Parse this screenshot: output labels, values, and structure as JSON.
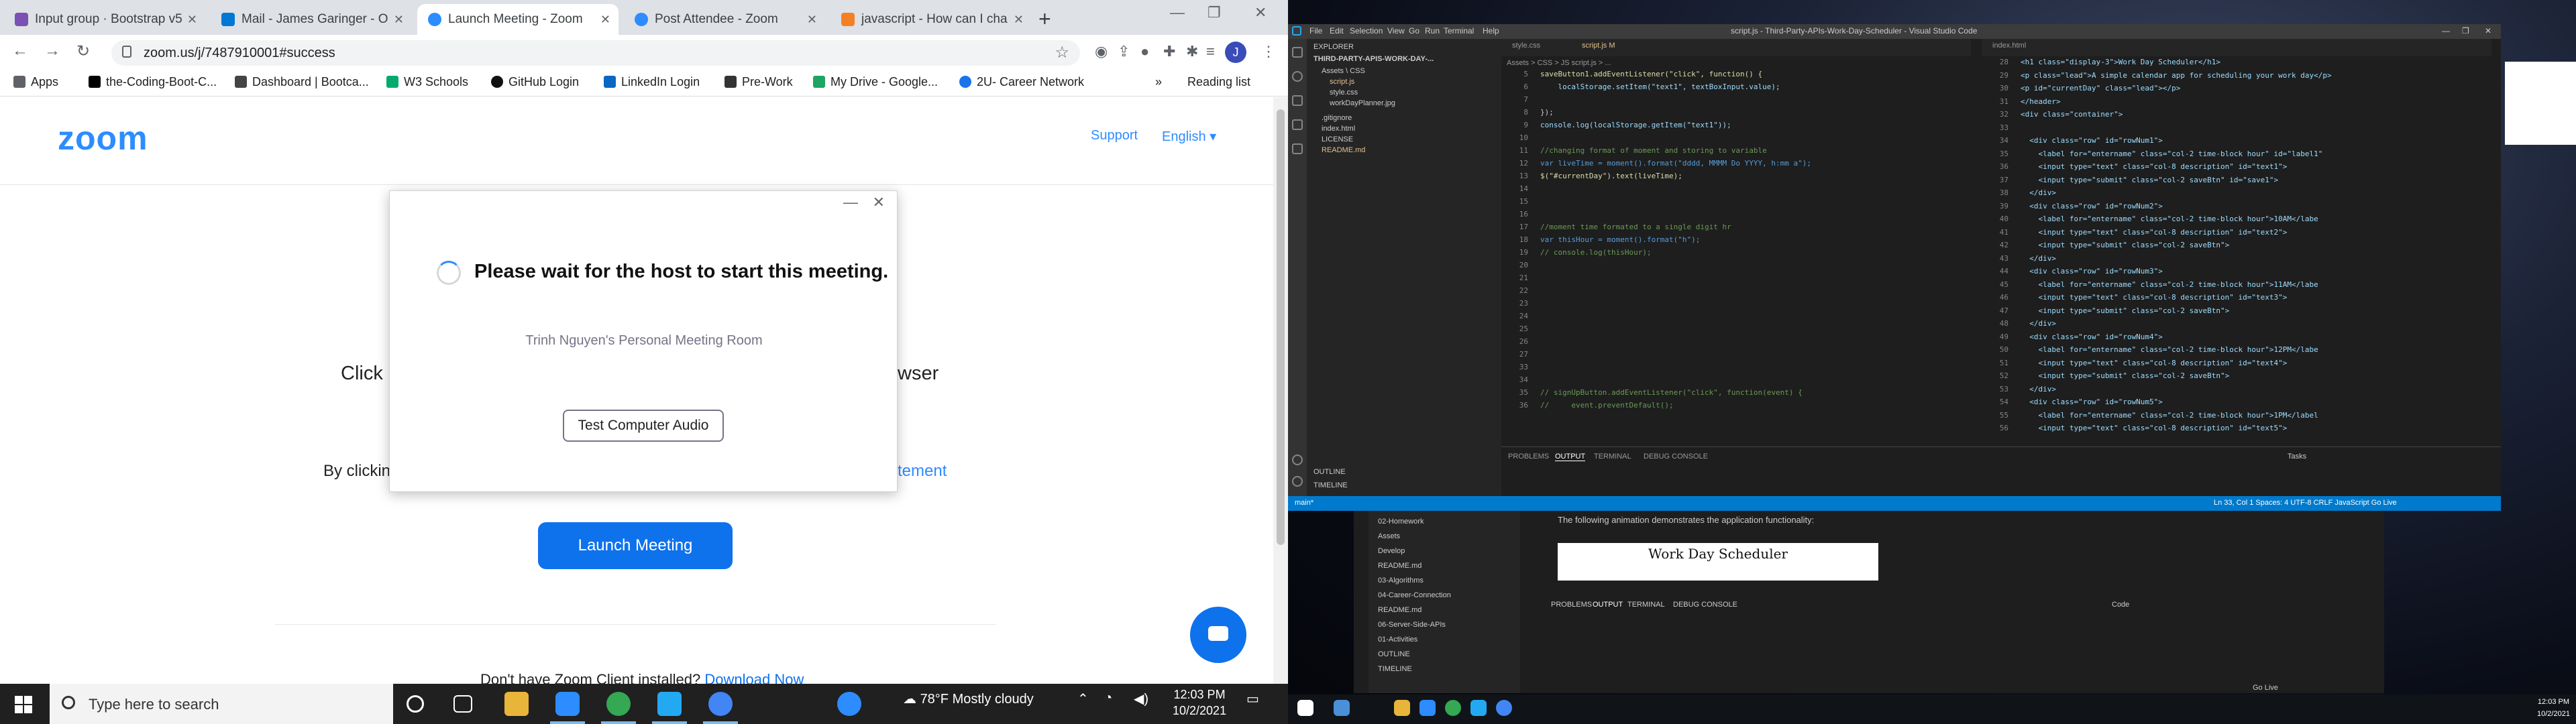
{
  "browser": {
    "tabs": [
      {
        "title": "Input group · Bootstrap v5",
        "color": "#7952b3"
      },
      {
        "title": "Mail - James Garinger - O",
        "color": "#0078d4"
      },
      {
        "title": "Launch Meeting - Zoom",
        "color": "#2d8cff"
      },
      {
        "title": "Post Attendee - Zoom",
        "color": "#2d8cff"
      },
      {
        "title": "javascript - How can I cha",
        "color": "#f48024"
      }
    ],
    "url": "zoom.us/j/7487910001#success",
    "avatar_letter": "J",
    "bookmarks": [
      {
        "label": "Apps",
        "color": "#5f6368"
      },
      {
        "label": "the-Coding-Boot-C...",
        "color": "#000000"
      },
      {
        "label": "Dashboard | Bootca...",
        "color": "#444444"
      },
      {
        "label": "W3 Schools",
        "color": "#04aa6d"
      },
      {
        "label": "GitHub Login",
        "color": "#111111"
      },
      {
        "label": "LinkedIn Login",
        "color": "#0a66c2"
      },
      {
        "label": "Pre-Work",
        "color": "#333333"
      },
      {
        "label": "My Drive - Google...",
        "color": "#1fa463"
      },
      {
        "label": "2U- Career Network",
        "color": "#1a73e8"
      }
    ],
    "reading_list": "Reading list",
    "more": "»"
  },
  "zoom": {
    "logo": "zoom",
    "support": "Support",
    "language": "English ▾",
    "click_text": "Click",
    "browser_text": "wser",
    "by_clicking": "By clickin",
    "statement": "tement",
    "launch_button": "Launch Meeting",
    "download_text": "Don't have Zoom Client installed?",
    "download_link": "Download Now"
  },
  "dialog": {
    "minimize": "—",
    "close": "✕",
    "message": "Please wait for the host to start this meeting.",
    "room": "Trinh Nguyen's Personal Meeting Room",
    "test_audio": "Test Computer Audio"
  },
  "taskbar": {
    "search_placeholder": "Type here to search",
    "weather": "78°F  Mostly cloudy",
    "time": "12:03 PM",
    "date": "10/2/2021"
  },
  "vscode": {
    "menu": [
      "File",
      "Edit",
      "Selection",
      "View",
      "Go",
      "Run",
      "Terminal",
      "Help"
    ],
    "title": "script.js - Third-Party-APIs-Work-Day-Scheduler - Visual Studio Code",
    "explorer": "EXPLORER",
    "project": "THIRD-PARTY-APIS-WORK-DAY-...",
    "files": [
      "Assets \\ CSS",
      "script.js",
      "style.css",
      "workDayPlanner.jpg",
      ".gitignore",
      "index.html",
      "LICENSE",
      "README.md"
    ],
    "tabs_left": [
      "style.css",
      "script.js M"
    ],
    "breadcrumb": "Assets > CSS > JS script.js > ...",
    "code_lines": [
      {
        "n": "5",
        "t": "saveButton1.addEventListener(\"click\", function() {",
        "c": "#dcdcaa"
      },
      {
        "n": "6",
        "t": "    localStorage.setItem(\"text1\", textBoxInput.value);",
        "c": "#9cdcfe"
      },
      {
        "n": "7",
        "t": "",
        "c": "#ccc"
      },
      {
        "n": "8",
        "t": "});",
        "c": "#ccc"
      },
      {
        "n": "9",
        "t": "console.log(localStorage.getItem(\"text1\"));",
        "c": "#9cdcfe"
      },
      {
        "n": "10",
        "t": "",
        "c": "#ccc"
      },
      {
        "n": "11",
        "t": "//changing format of moment and storing to variable",
        "c": "#6a9955"
      },
      {
        "n": "12",
        "t": "var liveTime = moment().format(\"dddd, MMMM Do YYYY, h:mm a\");",
        "c": "#569cd6"
      },
      {
        "n": "13",
        "t": "$(\"#currentDay\").text(liveTime);",
        "c": "#dcdcaa"
      },
      {
        "n": "14",
        "t": "",
        "c": "#ccc"
      },
      {
        "n": "15",
        "t": "",
        "c": "#ccc"
      },
      {
        "n": "16",
        "t": "",
        "c": "#ccc"
      },
      {
        "n": "17",
        "t": "//moment time formated to a single digit hr",
        "c": "#6a9955"
      },
      {
        "n": "18",
        "t": "var thisHour = moment().format(\"h\");",
        "c": "#569cd6"
      },
      {
        "n": "19",
        "t": "// console.log(thisHour);",
        "c": "#6a9955"
      },
      {
        "n": "20",
        "t": "",
        "c": "#ccc"
      },
      {
        "n": "21",
        "t": "",
        "c": "#ccc"
      },
      {
        "n": "22",
        "t": "",
        "c": "#ccc"
      },
      {
        "n": "23",
        "t": "",
        "c": "#ccc"
      },
      {
        "n": "24",
        "t": "",
        "c": "#ccc"
      },
      {
        "n": "25",
        "t": "",
        "c": "#ccc"
      },
      {
        "n": "26",
        "t": "",
        "c": "#ccc"
      },
      {
        "n": "27",
        "t": "",
        "c": "#ccc"
      },
      {
        "n": "33",
        "t": "",
        "c": "#ccc"
      },
      {
        "n": "34",
        "t": "",
        "c": "#ccc"
      },
      {
        "n": "35",
        "t": "// signUpButton.addEventListener(\"click\", function(event) {",
        "c": "#6a9955"
      },
      {
        "n": "36",
        "t": "//     event.preventDefault();",
        "c": "#6a9955"
      }
    ],
    "tabs_right": [
      "index.html"
    ],
    "html_lines": [
      {
        "n": "28",
        "t": "<h1 class=\"display-3\">Work Day Scheduler</h1>"
      },
      {
        "n": "29",
        "t": "<p class=\"lead\">A simple calendar app for scheduling your work day</p>"
      },
      {
        "n": "30",
        "t": "<p id=\"currentDay\" class=\"lead\"></p>"
      },
      {
        "n": "31",
        "t": "</header>"
      },
      {
        "n": "32",
        "t": "<div class=\"container\">"
      },
      {
        "n": "33",
        "t": ""
      },
      {
        "n": "34",
        "t": "  <div class=\"row\" id=\"rowNum1\">"
      },
      {
        "n": "35",
        "t": "    <label for=\"entername\" class=\"col-2 time-block hour\" id=\"label1\""
      },
      {
        "n": "36",
        "t": "    <input type=\"text\" class=\"col-8 description\" id=\"text1\">"
      },
      {
        "n": "37",
        "t": "    <input type=\"submit\" class=\"col-2 saveBtn\" id=\"save1\">"
      },
      {
        "n": "38",
        "t": "  </div>"
      },
      {
        "n": "39",
        "t": "  <div class=\"row\" id=\"rowNum2\">"
      },
      {
        "n": "40",
        "t": "    <label for=\"entername\" class=\"col-2 time-block hour\">10AM</labe"
      },
      {
        "n": "41",
        "t": "    <input type=\"text\" class=\"col-8 description\" id=\"text2\">"
      },
      {
        "n": "42",
        "t": "    <input type=\"submit\" class=\"col-2 saveBtn\">"
      },
      {
        "n": "43",
        "t": "  </div>"
      },
      {
        "n": "44",
        "t": "  <div class=\"row\" id=\"rowNum3\">"
      },
      {
        "n": "45",
        "t": "    <label for=\"entername\" class=\"col-2 time-block hour\">11AM</labe"
      },
      {
        "n": "46",
        "t": "    <input type=\"text\" class=\"col-8 description\" id=\"text3\">"
      },
      {
        "n": "47",
        "t": "    <input type=\"submit\" class=\"col-2 saveBtn\">"
      },
      {
        "n": "48",
        "t": "  </div>"
      },
      {
        "n": "49",
        "t": "  <div class=\"row\" id=\"rowNum4\">"
      },
      {
        "n": "50",
        "t": "    <label for=\"entername\" class=\"col-2 time-block hour\">12PM</labe"
      },
      {
        "n": "51",
        "t": "    <input type=\"text\" class=\"col-8 description\" id=\"text4\">"
      },
      {
        "n": "52",
        "t": "    <input type=\"submit\" class=\"col-2 saveBtn\">"
      },
      {
        "n": "53",
        "t": "  </div>"
      },
      {
        "n": "54",
        "t": "  <div class=\"row\" id=\"rowNum5\">"
      },
      {
        "n": "55",
        "t": "    <label for=\"entername\" class=\"col-2 time-block hour\">1PM</label"
      },
      {
        "n": "56",
        "t": "    <input type=\"text\" class=\"col-8 description\" id=\"text5\">"
      }
    ],
    "panel_tabs": [
      "PROBLEMS",
      "OUTPUT",
      "TERMINAL",
      "DEBUG CONSOLE"
    ],
    "panel_select": "Tasks",
    "outline": "OUTLINE",
    "timeline": "TIMELINE",
    "status_left": "main*",
    "status_right": "Ln 33, Col 1   Spaces: 4   UTF-8   CRLF   JavaScript   Go Live"
  },
  "vscode2": {
    "tree": [
      "02-Homework",
      "Assets",
      "Develop",
      "README.md",
      "03-Algorithms",
      "04-Career-Connection",
      "README.md",
      "06-Server-Side-APIs",
      "01-Activities",
      "OUTLINE",
      "TIMELINE"
    ],
    "preview_text": "The following animation demonstrates the application functionality:",
    "preview_title": "Work Day Scheduler",
    "panel_tabs": [
      "PROBLEMS",
      "OUTPUT",
      "TERMINAL",
      "DEBUG CONSOLE"
    ],
    "select": "Code",
    "golive": "Go Live"
  },
  "right_clock": {
    "time": "12:03 PM",
    "date": "10/2/2021"
  }
}
